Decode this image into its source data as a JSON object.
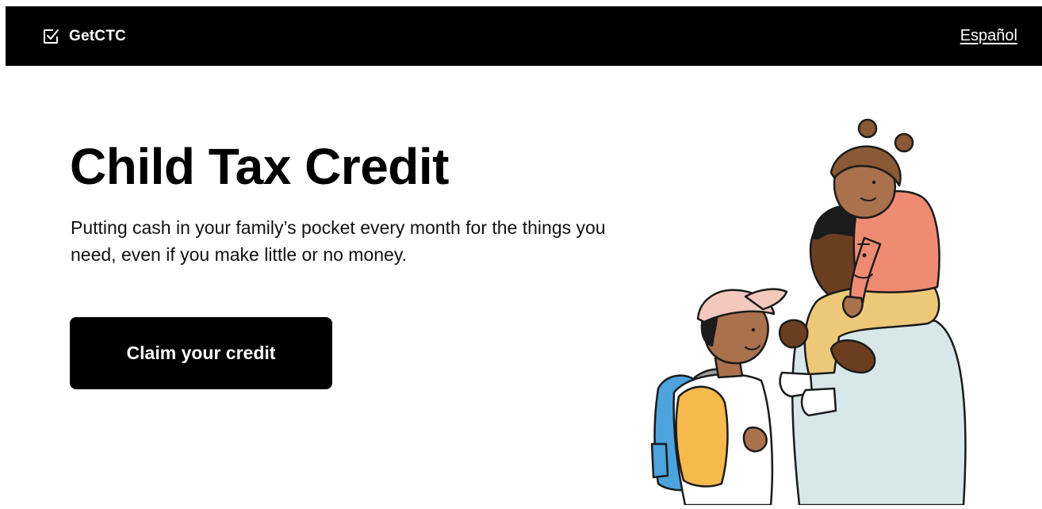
{
  "header": {
    "brand_name": "GetCTC",
    "brand_icon": "checkbox-check-icon",
    "language_link": "Español"
  },
  "hero": {
    "title": "Child Tax Credit",
    "subtitle": "Putting cash in your family’s pocket every month for the things you need, even if you make little or no money.",
    "cta_label": "Claim your credit"
  },
  "colors": {
    "header_bg": "#000000",
    "button_bg": "#000000",
    "text": "#000000",
    "background": "#ffffff",
    "shirt_coral": "#ef8b72",
    "pants_yellow": "#edc878",
    "sweater_light_blue": "#d8e8ea",
    "backpack_blue": "#4ca3dd",
    "cap_pink": "#f3c9bd",
    "sleeve_yellow": "#f5b94c"
  }
}
